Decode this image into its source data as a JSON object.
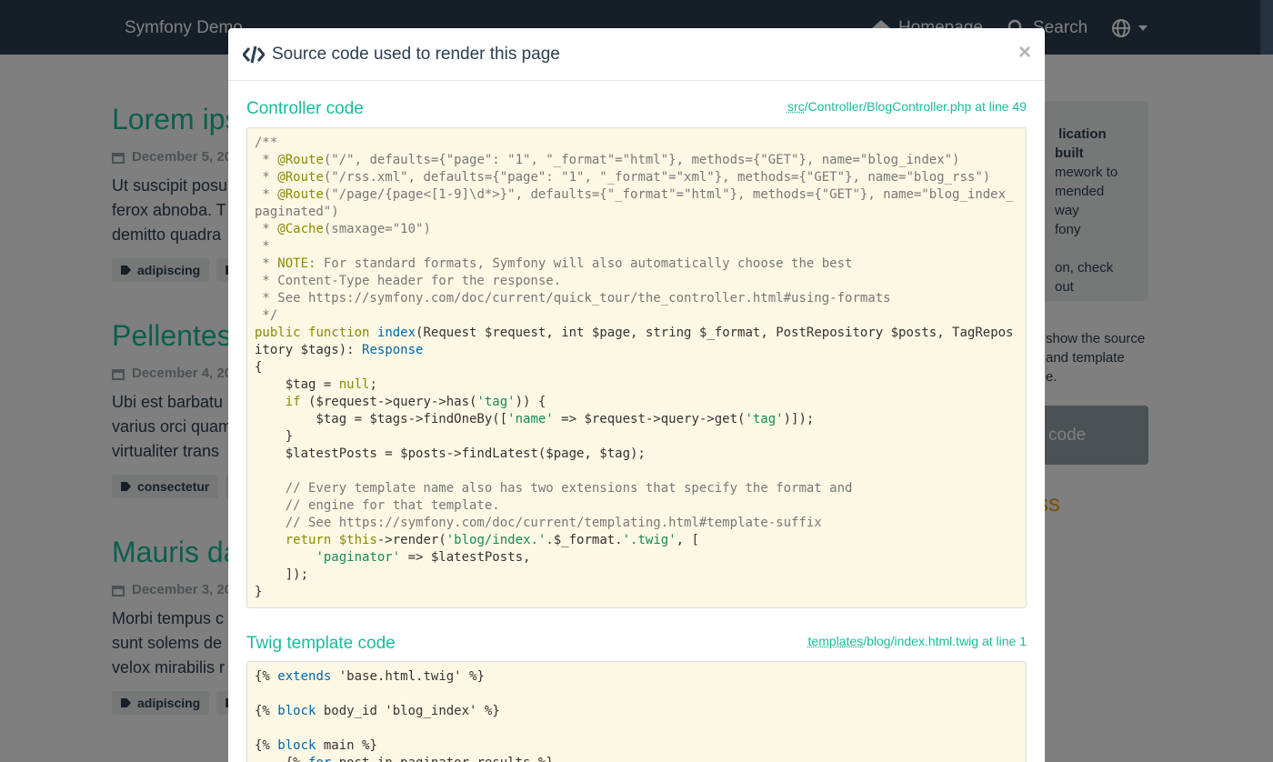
{
  "navbar": {
    "brand": "Symfony Demo",
    "homepage": "Homepage",
    "search": "Search"
  },
  "posts": [
    {
      "title": "Lorem ips",
      "date": "December 5, 20",
      "summary": [
        "Ut suscipit posu",
        "ferox abnoba. T",
        "demitto quadra"
      ],
      "tags": [
        "adipiscing",
        ""
      ]
    },
    {
      "title": "Pellentes",
      "date": "December 4, 20",
      "summary": [
        "Ubi est barbatu",
        "varius orci quam",
        "virtualiter trans"
      ],
      "tags": [
        "consectetur",
        ""
      ]
    },
    {
      "title": "Mauris da",
      "date": "December 3, 20",
      "summary": [
        "Morbi tempus c",
        "sunt solems de",
        "velox mirabilis r"
      ],
      "tags": [
        "adipiscing",
        ""
      ]
    }
  ],
  "sidebar": {
    "well_lines": [
      "lication built",
      "mework to",
      "mended way",
      "fony",
      "",
      "on, check out"
    ],
    "text_lines": [
      "show the source",
      "and template",
      "e."
    ],
    "button": "code",
    "orange": "ss"
  },
  "modal": {
    "title": "Source code used to render this page",
    "close": "×",
    "controller": {
      "heading": "Controller code",
      "file_abbr": "src",
      "file_rest": "/Controller/BlogController.php at line 49"
    },
    "template": {
      "heading": "Twig template code",
      "file_abbr": "templates",
      "file_rest": "/blog/index.html.twig at line 1"
    }
  }
}
